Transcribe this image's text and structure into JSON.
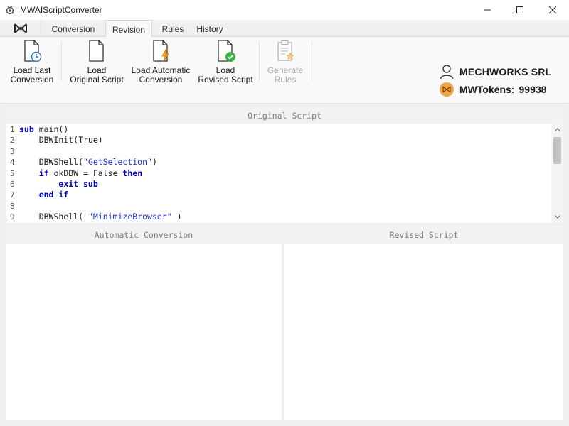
{
  "window": {
    "title": "MWAIScriptConverter",
    "app_icon": "bug-gear-icon",
    "controls": [
      "minimize-icon",
      "maximize-icon",
      "close-icon"
    ]
  },
  "menu": {
    "app_button_icon": "mw-logo-icon",
    "tabs": [
      {
        "label": "Conversion",
        "active": false
      },
      {
        "label": "Revision",
        "active": true
      },
      {
        "label": "Rules",
        "active": false
      },
      {
        "label": "History",
        "active": false
      }
    ]
  },
  "ribbon": {
    "buttons": [
      {
        "label": "Load Last\nConversion",
        "icon": "document-clock-icon",
        "enabled": true
      },
      {
        "label": "Load\nOriginal Script",
        "icon": "document-icon",
        "enabled": true
      },
      {
        "label": "Load Automatic\nConversion",
        "icon": "document-bolt-icon",
        "enabled": true
      },
      {
        "label": "Load\nRevised Script",
        "icon": "document-check-icon",
        "enabled": true
      },
      {
        "label": "Generate\nRules",
        "icon": "clipboard-star-icon",
        "enabled": false
      }
    ],
    "account": {
      "user_icon": "user-icon",
      "company": "MECHWORKS SRL",
      "tokens_icon": "mw-coin-icon",
      "tokens_label": "MWTokens:",
      "tokens_value": "99938"
    }
  },
  "panels": {
    "original": {
      "title": "Original Script",
      "lines": [
        {
          "n": "1",
          "code": [
            {
              "t": "sub",
              "k": "kw"
            },
            {
              "t": " main()",
              "k": ""
            }
          ]
        },
        {
          "n": "2",
          "code": [
            {
              "t": "    DBWInit(True)",
              "k": ""
            }
          ]
        },
        {
          "n": "3",
          "code": []
        },
        {
          "n": "4",
          "code": [
            {
              "t": "    DBWShell(",
              "k": ""
            },
            {
              "t": "\"GetSelection\"",
              "k": "str"
            },
            {
              "t": ")",
              "k": ""
            }
          ]
        },
        {
          "n": "5",
          "code": [
            {
              "t": "    ",
              "k": ""
            },
            {
              "t": "if",
              "k": "kw"
            },
            {
              "t": " okDBW = False ",
              "k": ""
            },
            {
              "t": "then",
              "k": "kw"
            }
          ]
        },
        {
          "n": "6",
          "code": [
            {
              "t": "        ",
              "k": ""
            },
            {
              "t": "exit sub",
              "k": "kw"
            }
          ]
        },
        {
          "n": "7",
          "code": [
            {
              "t": "    ",
              "k": ""
            },
            {
              "t": "end if",
              "k": "kw"
            }
          ]
        },
        {
          "n": "8",
          "code": []
        },
        {
          "n": "9",
          "code": [
            {
              "t": "    DBWShell( ",
              "k": ""
            },
            {
              "t": "\"MinimizeBrowser\"",
              "k": "str"
            },
            {
              "t": " )",
              "k": ""
            }
          ]
        }
      ]
    },
    "automatic": {
      "title": "Automatic Conversion"
    },
    "revised": {
      "title": "Revised Script"
    }
  }
}
